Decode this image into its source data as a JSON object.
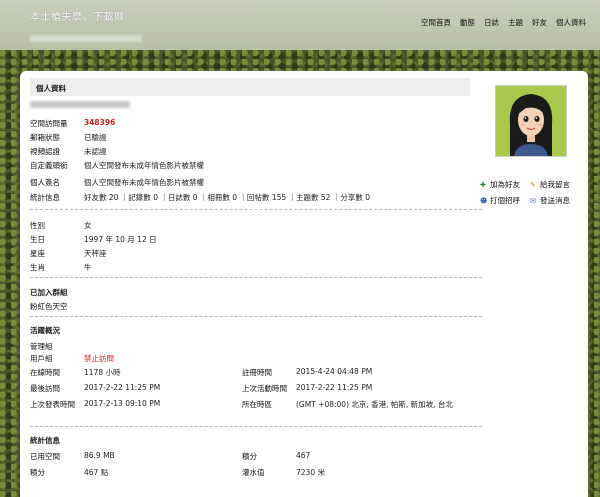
{
  "header": {
    "site_title": "本土槍失麼，下載姬",
    "nav": [
      "空間首頁",
      "動態",
      "日誌",
      "主題",
      "好友",
      "個人資料"
    ]
  },
  "panel": {
    "title": "個人資料"
  },
  "profile": {
    "basic": [
      {
        "label": "空間訪問量",
        "value": "348396"
      },
      {
        "label": "郵箱狀態",
        "value": "已驗證"
      },
      {
        "label": "視頻認證",
        "value": "未認證"
      },
      {
        "label": "自定義頭銜",
        "value": "個人空間發布未成年情色影片被禁權"
      },
      {
        "label": "個人簽名",
        "value": "個人空間發布未成年情色影片被禁權"
      },
      {
        "label": "統計信息",
        "value": "好友數 20 ｜記錄數 0 ｜日誌數 0 ｜相冊數 0 ｜回帖數 155 ｜主題數 52 ｜分享數 0"
      }
    ],
    "personal": [
      {
        "label": "性別",
        "value": "女"
      },
      {
        "label": "生日",
        "value": "1997 年 10 月 12 日"
      },
      {
        "label": "星座",
        "value": "天秤座"
      },
      {
        "label": "生肖",
        "value": "牛"
      }
    ]
  },
  "groups": {
    "title": "已加入群組",
    "value": "粉紅色天空"
  },
  "activity": {
    "title": "活躍概況",
    "admin_group_label": "管理組",
    "user_group_label": "用戶組",
    "user_group_value": "禁止訪問",
    "online_label": "在線時間",
    "online_value": "1178 小時",
    "register_label": "註冊時間",
    "register_value": "2015-4-24 04:48 PM",
    "last_visit_label": "最後訪問",
    "last_visit_value": "2017-2-22 11:25 PM",
    "last_active_label": "上次活動時間",
    "last_active_value": "2017-2-22 11:25 PM",
    "last_post_label": "上次發表時間",
    "last_post_value": "2017-2-13 09:10 PM",
    "timezone_label": "所在時區",
    "timezone_value": "(GMT +08:00) 北京, 香港, 帕斯, 新加坡, 台北"
  },
  "stats": {
    "title": "統計信息",
    "space_label": "已用空間",
    "space_value": "86.9 MB",
    "points_label": "積分",
    "points_value": "467",
    "credits_label": "積分",
    "credits_value": "467 點",
    "water_label": "灌水值",
    "water_value": "7230 米"
  },
  "side_links": [
    {
      "icon": "add-friend-icon",
      "label": "加為好友"
    },
    {
      "icon": "message-icon",
      "label": "給我留言"
    },
    {
      "icon": "poke-icon",
      "label": "打個招呼"
    },
    {
      "icon": "mail-icon",
      "label": "發送消息"
    }
  ]
}
